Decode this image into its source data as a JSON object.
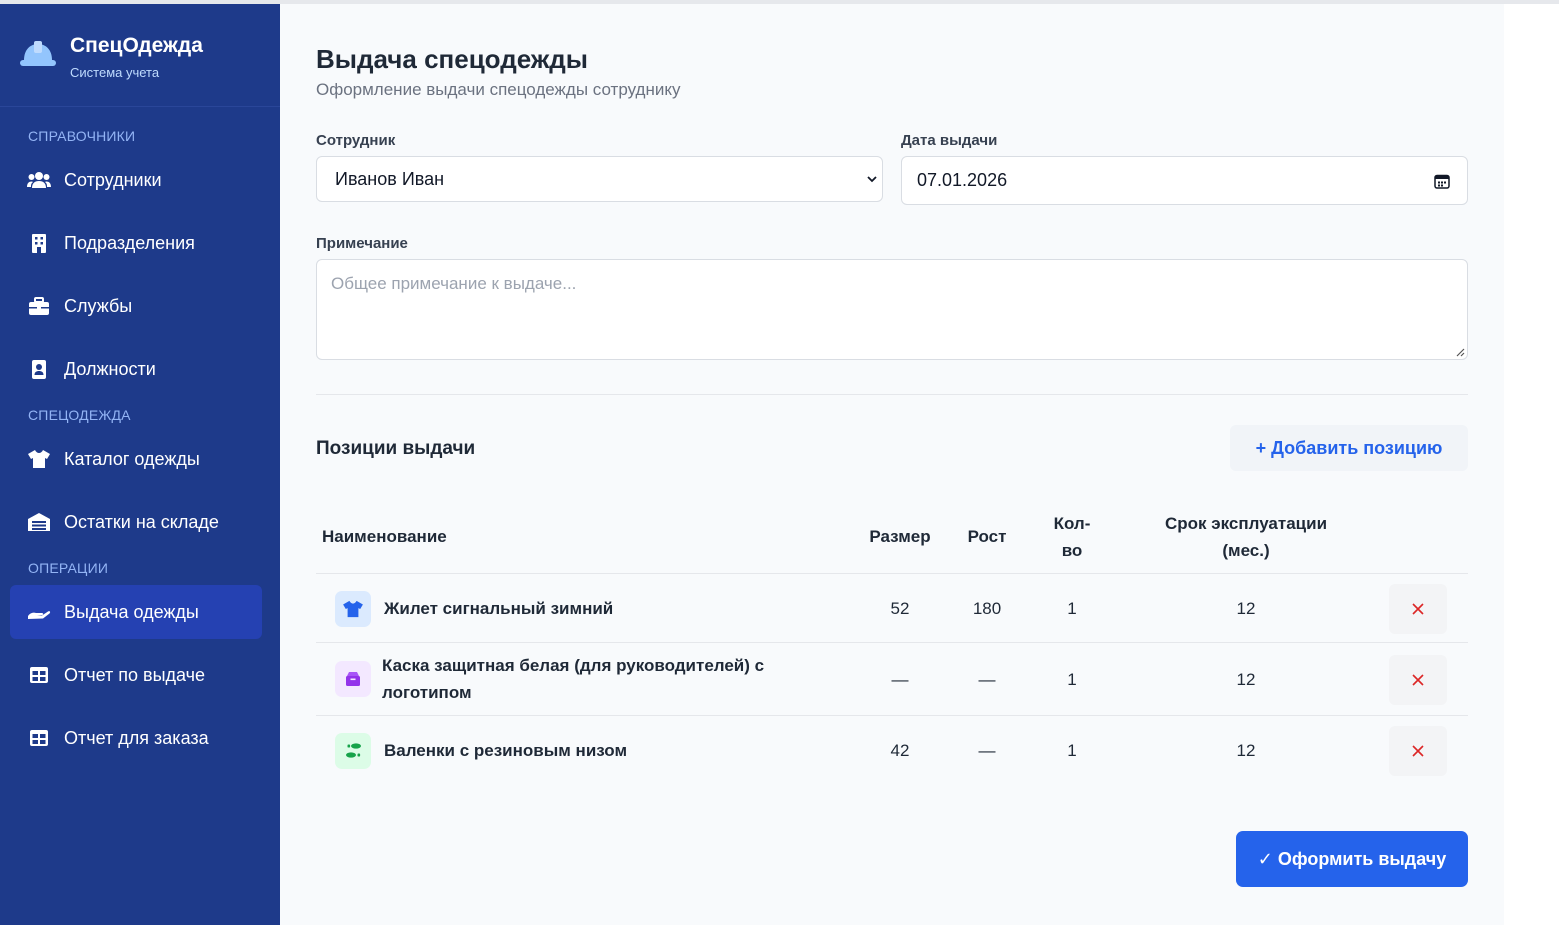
{
  "brand": {
    "title": "СпецОдежда",
    "subtitle": "Система учета"
  },
  "sidebar": {
    "sections": [
      {
        "label": "СПРАВОЧНИКИ"
      },
      {
        "label": "СПЕЦОДЕЖДА"
      },
      {
        "label": "ОПЕРАЦИИ"
      }
    ],
    "items": [
      {
        "label": "Сотрудники",
        "icon": "users-icon"
      },
      {
        "label": "Подразделения",
        "icon": "building-icon"
      },
      {
        "label": "Службы",
        "icon": "briefcase-icon"
      },
      {
        "label": "Должности",
        "icon": "id-badge-icon"
      },
      {
        "label": "Каталог одежды",
        "icon": "tshirt-icon"
      },
      {
        "label": "Остатки на складе",
        "icon": "warehouse-icon"
      },
      {
        "label": "Выдача одежды",
        "icon": "hand-holding-icon",
        "active": true
      },
      {
        "label": "Отчет по выдаче",
        "icon": "table-icon"
      },
      {
        "label": "Отчет для заказа",
        "icon": "table-icon"
      }
    ]
  },
  "page": {
    "title": "Выдача спецодежды",
    "subtitle": "Оформление выдачи спецодежды сотруднику"
  },
  "form": {
    "employee_label": "Сотрудник",
    "employee_value": "Иванов Иван",
    "date_label": "Дата выдачи",
    "date_value": "07.01.2026",
    "note_label": "Примечание",
    "note_placeholder": "Общее примечание к выдаче..."
  },
  "positions": {
    "title": "Позиции выдачи",
    "add_label": "+ Добавить позицию",
    "columns": {
      "name": "Наименование",
      "size": "Размер",
      "height": "Рост",
      "qty_line1": "Кол-",
      "qty_line2": "во",
      "term_line1": "Срок эксплуатации",
      "term_line2": "(мес.)"
    },
    "rows": [
      {
        "name": "Жилет сигнальный зимний",
        "size": "52",
        "height": "180",
        "qty": "1",
        "term": "12",
        "icon": "tshirt-icon",
        "icon_color": "#2563eb",
        "icon_bg": "#dbeafe"
      },
      {
        "name": "Каска защитная белая (для руководителей) с логотипом",
        "size": "—",
        "height": "—",
        "qty": "1",
        "term": "12",
        "icon": "box-icon",
        "icon_color": "#9333ea",
        "icon_bg": "#f3e8ff"
      },
      {
        "name": "Валенки с резиновым низом",
        "size": "42",
        "height": "—",
        "qty": "1",
        "term": "12",
        "icon": "shoe-prints-icon",
        "icon_color": "#16a34a",
        "icon_bg": "#dcfce7"
      }
    ]
  },
  "submit_label": "✓ Оформить выдачу",
  "colors": {
    "sidebar": "#1e3a8a",
    "active": "#2541b2",
    "accent": "#2563eb",
    "danger": "#dc2626"
  }
}
